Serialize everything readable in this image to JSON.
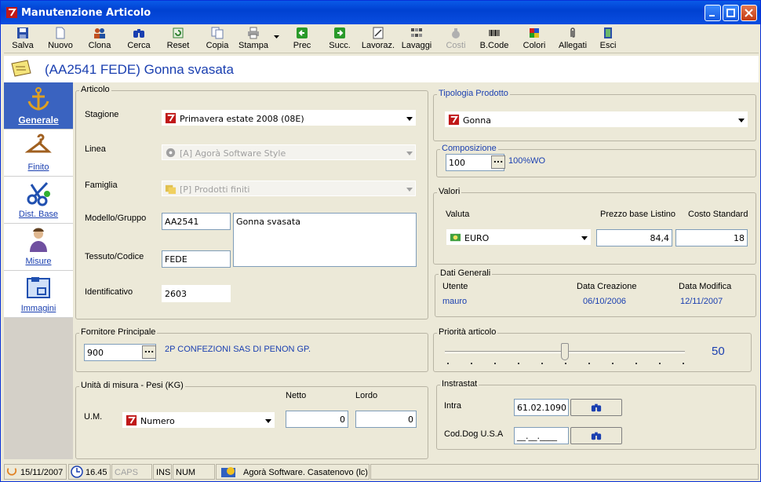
{
  "window": {
    "title": "Manutenzione Articolo"
  },
  "toolbar": {
    "salva": "Salva",
    "nuovo": "Nuovo",
    "clona": "Clona",
    "cerca": "Cerca",
    "reset": "Reset",
    "copia": "Copia",
    "stampa": "Stampa",
    "prec": "Prec",
    "succ": "Succ.",
    "lavoraz": "Lavoraz.",
    "lavaggi": "Lavaggi",
    "costi": "Costi",
    "bcode": "B.Code",
    "colori": "Colori",
    "allegati": "Allegati",
    "esci": "Esci"
  },
  "header": {
    "title": "(AA2541   FEDE) Gonna svasata"
  },
  "nav": {
    "generale": "Generale",
    "finito": "Finito",
    "dist_base": "Dist. Base",
    "misure": "Misure",
    "immagini": "Immagini"
  },
  "articolo": {
    "group_title": "Articolo",
    "stagione_label": "Stagione",
    "stagione_value": "Primavera estate 2008  (08E)",
    "linea_label": "Linea",
    "linea_value": "[A] Agorà Software Style",
    "famiglia_label": "Famiglia",
    "famiglia_value": "[P] Prodotti finiti",
    "modello_label": "Modello/Gruppo",
    "modello_value": "AA2541",
    "descrizione_value": "Gonna svasata",
    "tessuto_label": "Tessuto/Codice",
    "tessuto_value": "FEDE",
    "identificativo_label": "Identificativo",
    "identificativo_value": "2603"
  },
  "fornitore": {
    "group_title": "Fornitore Principale",
    "code": "900",
    "name": "2P CONFEZIONI SAS DI PENON GP."
  },
  "um": {
    "group_title": "Unità di misura - Pesi (KG)",
    "netto_label": "Netto",
    "lordo_label": "Lordo",
    "um_label": "U.M.",
    "um_value": "Numero",
    "netto_value": "0",
    "lordo_value": "0"
  },
  "tipologia": {
    "group_title": "Tipologia Prodotto",
    "value": "Gonna"
  },
  "composizione": {
    "group_title": "Composizione",
    "code": "100",
    "desc": "100%WO"
  },
  "valori": {
    "group_title": "Valori",
    "valuta_label": "Valuta",
    "prezzo_label": "Prezzo base Listino",
    "costo_label": "Costo Standard",
    "valuta_value": "EURO",
    "prezzo_value": "84,4",
    "costo_value": "18"
  },
  "dati_generali": {
    "group_title": "Dati Generali",
    "utente_label": "Utente",
    "creazione_label": "Data Creazione",
    "modifica_label": "Data Modifica",
    "utente_value": "mauro",
    "creazione_value": "06/10/2006",
    "modifica_value": "12/11/2007"
  },
  "priorita": {
    "group_title": "Priorità articolo",
    "value": "50",
    "fraction": 0.5
  },
  "intrastat": {
    "group_title": "Instrastat",
    "intra_label": "Intra",
    "intra_value": "61.02.1090",
    "coddog_label": "Cod.Dog U.S.A",
    "coddog_value": "__.__.____"
  },
  "statusbar": {
    "date": "15/11/2007",
    "time": "16.45",
    "caps": "CAPS",
    "ins": "INS",
    "num": "NUM",
    "company": "Agorà Software. Casatenovo (lc)"
  }
}
